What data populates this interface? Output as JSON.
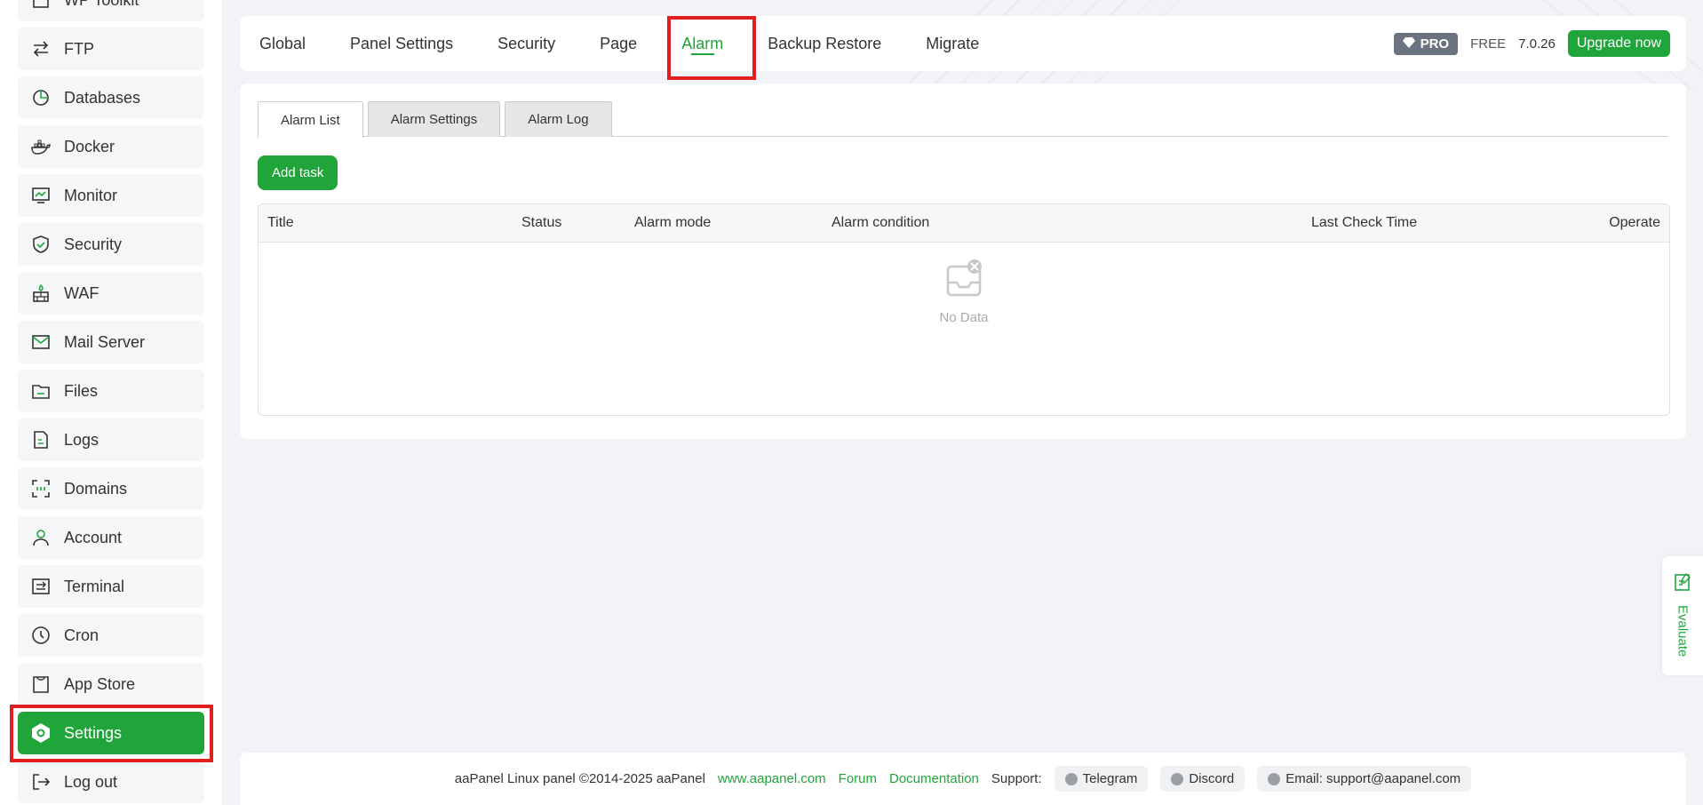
{
  "sidebar": {
    "items": [
      {
        "label": "WP Toolkit",
        "icon": "wordpress-icon"
      },
      {
        "label": "FTP",
        "icon": "transfer-icon"
      },
      {
        "label": "Databases",
        "icon": "database-icon"
      },
      {
        "label": "Docker",
        "icon": "docker-icon"
      },
      {
        "label": "Monitor",
        "icon": "monitor-icon"
      },
      {
        "label": "Security",
        "icon": "shield-icon"
      },
      {
        "label": "WAF",
        "icon": "firewall-icon"
      },
      {
        "label": "Mail Server",
        "icon": "mail-icon"
      },
      {
        "label": "Files",
        "icon": "folder-icon"
      },
      {
        "label": "Logs",
        "icon": "log-icon"
      },
      {
        "label": "Domains",
        "icon": "domain-icon"
      },
      {
        "label": "Account",
        "icon": "user-icon"
      },
      {
        "label": "Terminal",
        "icon": "terminal-icon"
      },
      {
        "label": "Cron",
        "icon": "clock-icon"
      },
      {
        "label": "App Store",
        "icon": "store-icon"
      },
      {
        "label": "Settings",
        "icon": "settings-icon"
      },
      {
        "label": "Log out",
        "icon": "logout-icon"
      }
    ]
  },
  "topnav": {
    "tabs": [
      "Global",
      "Panel Settings",
      "Security",
      "Page",
      "Alarm",
      "Backup Restore",
      "Migrate"
    ],
    "pro_label": "PRO",
    "free_label": "FREE",
    "version": "7.0.26",
    "upgrade_label": "Upgrade now"
  },
  "panel": {
    "subtabs": [
      "Alarm List",
      "Alarm Settings",
      "Alarm Log"
    ],
    "add_task_label": "Add task",
    "columns": [
      "Title",
      "Status",
      "Alarm mode",
      "Alarm condition",
      "Last Check Time",
      "Operate"
    ],
    "empty_text": "No Data"
  },
  "evaluate": {
    "label": "Evaluate"
  },
  "footer": {
    "copyright": "aaPanel Linux panel ©2014-2025 aaPanel",
    "site_link": "www.aapanel.com",
    "forum_link": "Forum",
    "docs_link": "Documentation",
    "support_label": "Support:",
    "telegram": "Telegram",
    "discord": "Discord",
    "email": "Email: support@aapanel.com"
  },
  "colors": {
    "accent": "#20a53a",
    "highlight": "#e02020"
  }
}
